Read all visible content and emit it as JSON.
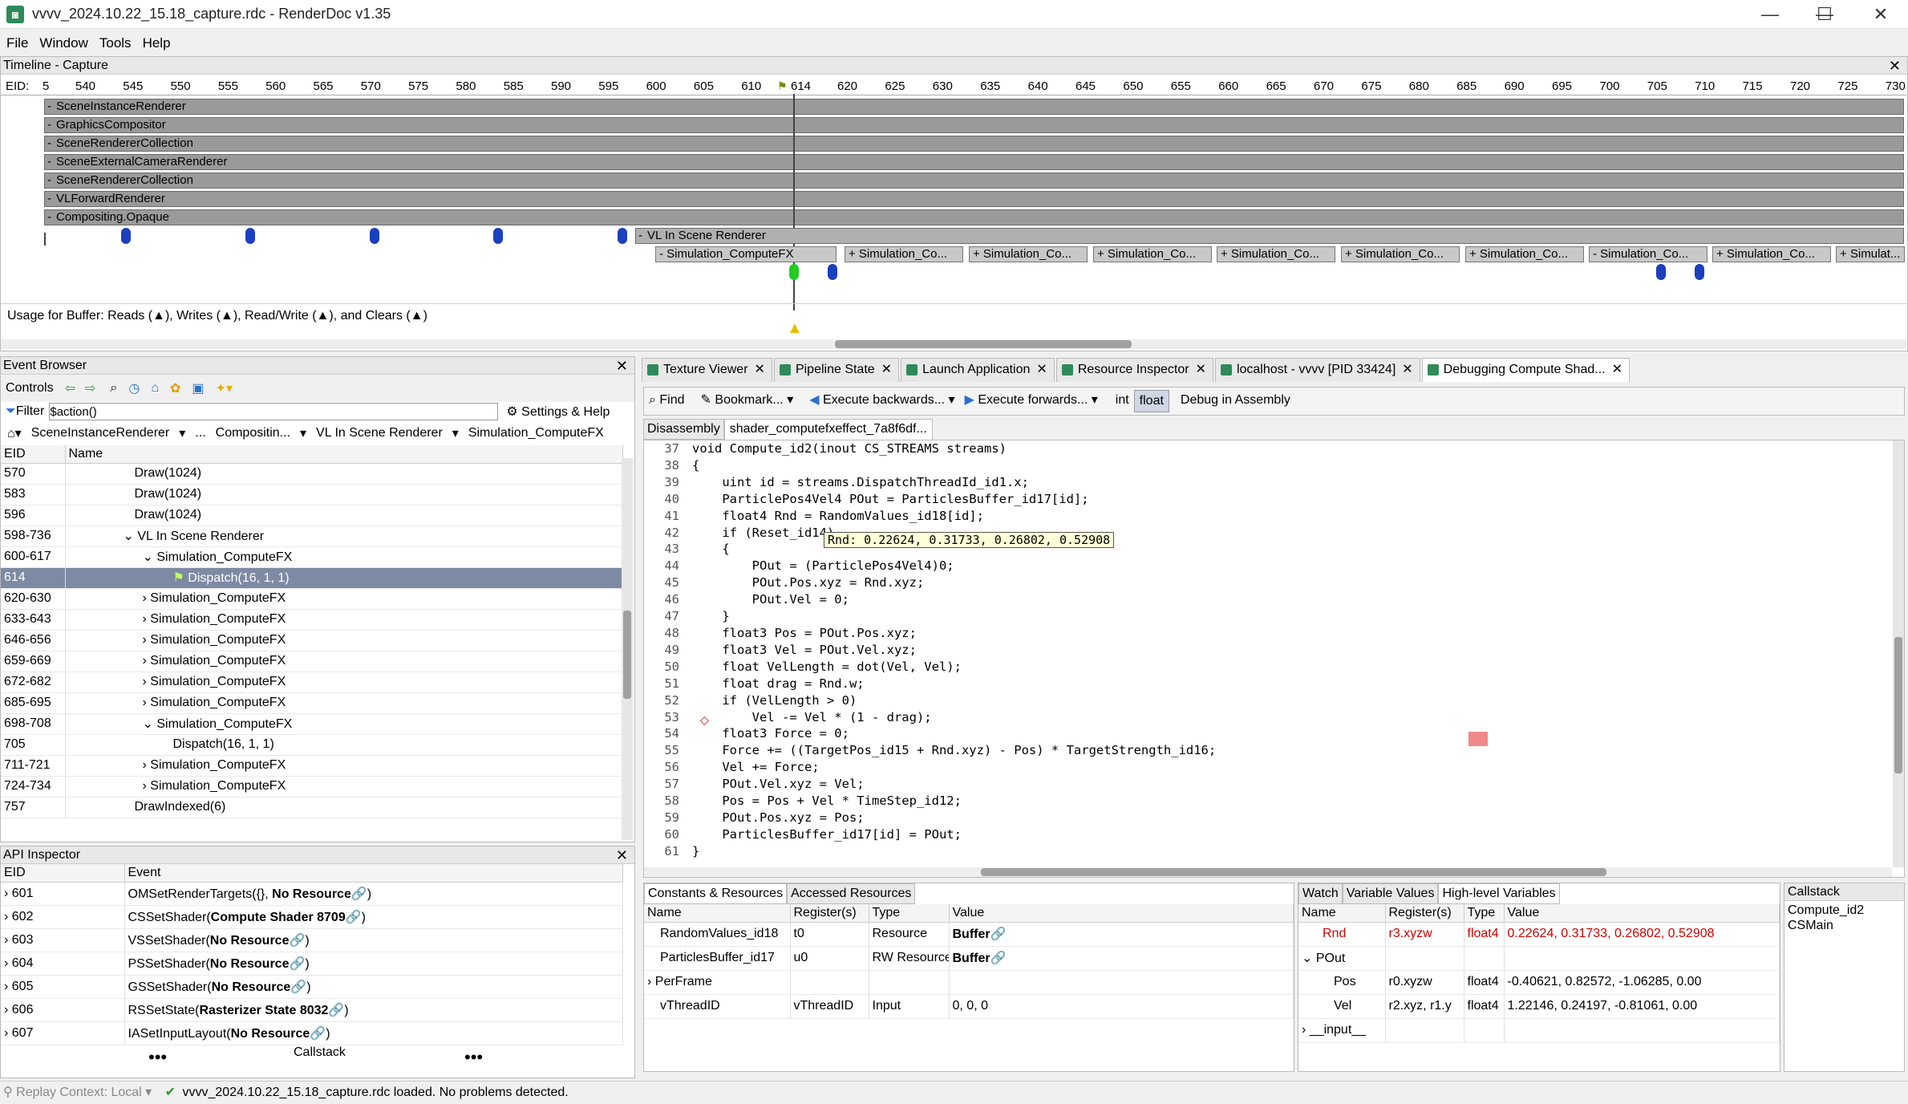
{
  "window": {
    "title": "vvvv_2024.10.22_15.18_capture.rdc - RenderDoc v1.35"
  },
  "menu": [
    "File",
    "Window",
    "Tools",
    "Help"
  ],
  "timeline": {
    "header": "Timeline - Capture",
    "eid_label": "EID:",
    "ticks": [
      "5",
      "540",
      "545",
      "550",
      "555",
      "560",
      "565",
      "570",
      "575",
      "580",
      "585",
      "590",
      "595",
      "600",
      "605",
      "610",
      "614",
      "620",
      "625",
      "630",
      "635",
      "640",
      "645",
      "650",
      "655",
      "660",
      "665",
      "670",
      "675",
      "680",
      "685",
      "690",
      "695",
      "700",
      "705",
      "710",
      "715",
      "720",
      "725",
      "730"
    ],
    "rows": [
      "SceneInstanceRenderer",
      "GraphicsCompositor",
      "SceneRendererCollection",
      "SceneExternalCameraRenderer",
      "SceneRendererCollection",
      "VLForwardRenderer",
      "Compositing.Opaque"
    ],
    "vl_row": "VL In Scene Renderer",
    "sim_boxes": [
      "- Simulation_ComputeFX",
      "+ Simulation_Co...",
      "+ Simulation_Co...",
      "+ Simulation_Co...",
      "+ Simulation_Co...",
      "+ Simulation_Co...",
      "+ Simulation_Co...",
      "- Simulation_Co...",
      "+ Simulation_Co...",
      "+ Simulat..."
    ],
    "usage": "Usage for Buffer: Reads (▲), Writes (▲), Read/Write (▲), and Clears (▲)"
  },
  "event_browser": {
    "header": "Event Browser",
    "controls_label": "Controls",
    "filter_label": "Filter",
    "filter_value": "$action()",
    "settings": "Settings & Help",
    "breadcrumbs": [
      "SceneInstanceRenderer",
      "...",
      "Compositin...",
      "VL In Scene Renderer",
      "Simulation_ComputeFX"
    ],
    "columns": [
      "EID",
      "Name"
    ],
    "rows": [
      {
        "eid": "570",
        "name": "Draw(1024)",
        "indent": 3,
        "exp": ""
      },
      {
        "eid": "583",
        "name": "Draw(1024)",
        "indent": 3,
        "exp": ""
      },
      {
        "eid": "596",
        "name": "Draw(1024)",
        "indent": 3,
        "exp": ""
      },
      {
        "eid": "598-736",
        "name": "VL In Scene Renderer",
        "indent": 3,
        "exp": "v"
      },
      {
        "eid": "600-617",
        "name": "Simulation_ComputeFX",
        "indent": 4,
        "exp": "v"
      },
      {
        "eid": "614",
        "name": "Dispatch(16, 1, 1)",
        "indent": 5,
        "exp": "",
        "selected": true
      },
      {
        "eid": "620-630",
        "name": "Simulation_ComputeFX",
        "indent": 4,
        "exp": ">"
      },
      {
        "eid": "633-643",
        "name": "Simulation_ComputeFX",
        "indent": 4,
        "exp": ">"
      },
      {
        "eid": "646-656",
        "name": "Simulation_ComputeFX",
        "indent": 4,
        "exp": ">"
      },
      {
        "eid": "659-669",
        "name": "Simulation_ComputeFX",
        "indent": 4,
        "exp": ">"
      },
      {
        "eid": "672-682",
        "name": "Simulation_ComputeFX",
        "indent": 4,
        "exp": ">"
      },
      {
        "eid": "685-695",
        "name": "Simulation_ComputeFX",
        "indent": 4,
        "exp": ">"
      },
      {
        "eid": "698-708",
        "name": "Simulation_ComputeFX",
        "indent": 4,
        "exp": "v"
      },
      {
        "eid": "705",
        "name": "Dispatch(16, 1, 1)",
        "indent": 5,
        "exp": ""
      },
      {
        "eid": "711-721",
        "name": "Simulation_ComputeFX",
        "indent": 4,
        "exp": ">"
      },
      {
        "eid": "724-734",
        "name": "Simulation_ComputeFX",
        "indent": 4,
        "exp": ">"
      },
      {
        "eid": "757",
        "name": "DrawIndexed(6)",
        "indent": 3,
        "exp": ""
      }
    ]
  },
  "api_inspector": {
    "header": "API Inspector",
    "columns": [
      "EID",
      "Event"
    ],
    "rows": [
      {
        "eid": "601",
        "fn": "OMSetRenderTargets(",
        "arg": "{}, ",
        "bold": "No Resource",
        "end": ")"
      },
      {
        "eid": "602",
        "fn": "CSSetShader(",
        "arg": "",
        "bold": "Compute Shader 8709",
        "end": ")"
      },
      {
        "eid": "603",
        "fn": "VSSetShader(",
        "arg": "",
        "bold": "No Resource",
        "end": ")"
      },
      {
        "eid": "604",
        "fn": "PSSetShader(",
        "arg": "",
        "bold": "No Resource",
        "end": ")"
      },
      {
        "eid": "605",
        "fn": "GSSetShader(",
        "arg": "",
        "bold": "No Resource",
        "end": ")"
      },
      {
        "eid": "606",
        "fn": "RSSetState(",
        "arg": "",
        "bold": "Rasterizer State 8032",
        "end": ")"
      },
      {
        "eid": "607",
        "fn": "IASetInputLayout(",
        "arg": "",
        "bold": "No Resource",
        "end": ")"
      }
    ],
    "callstack": "Callstack"
  },
  "tabs": [
    {
      "label": "Texture Viewer"
    },
    {
      "label": "Pipeline State"
    },
    {
      "label": "Launch Application"
    },
    {
      "label": "Resource Inspector"
    },
    {
      "label": "localhost - vvvv [PID 33424]"
    },
    {
      "label": "Debugging Compute Shad...",
      "active": true
    }
  ],
  "debug_toolbar": {
    "find": "Find",
    "bookmark": "Bookmark...",
    "exec_back": "Execute backwards...",
    "exec_fwd": "Execute forwards...",
    "int": "int",
    "float": "float",
    "asm": "Debug in Assembly"
  },
  "code_tabs": [
    "Disassembly",
    "shader_computefxeffect_7a8f6df..."
  ],
  "code": [
    {
      "n": "37",
      "t": "void Compute_id2(inout CS_STREAMS streams)"
    },
    {
      "n": "38",
      "t": "{"
    },
    {
      "n": "39",
      "t": "    uint id = streams.DispatchThreadId_id1.x;"
    },
    {
      "n": "40",
      "t": "    ParticlePos4Vel4 POut = ParticlesBuffer_id17[id];"
    },
    {
      "n": "41",
      "t": "    float4 Rnd = RandomValues_id18[id];"
    },
    {
      "n": "42",
      "t": "    if (Reset_id14)"
    },
    {
      "n": "43",
      "t": "    {"
    },
    {
      "n": "44",
      "t": "        POut = (ParticlePos4Vel4)0;"
    },
    {
      "n": "45",
      "t": "        POut.Pos.xyz = Rnd.xyz;"
    },
    {
      "n": "46",
      "t": "        POut.Vel = 0;"
    },
    {
      "n": "47",
      "t": "    }"
    },
    {
      "n": "48",
      "t": "    float3 Pos = POut.Pos.xyz;"
    },
    {
      "n": "49",
      "t": "    float3 Vel = POut.Vel.xyz;"
    },
    {
      "n": "50",
      "t": "    float VelLength = dot(Vel, Vel);"
    },
    {
      "n": "51",
      "t": "    float drag = Rnd.w;"
    },
    {
      "n": "52",
      "t": "    if (VelLength > 0)"
    },
    {
      "n": "53",
      "t": "        Vel -= Vel * (1 - drag);"
    },
    {
      "n": "54",
      "t": "    float3 Force = 0;"
    },
    {
      "n": "55",
      "t": "    Force += ((TargetPos_id15 + Rnd.xyz) - Pos) * TargetStrength_id16;"
    },
    {
      "n": "56",
      "t": "    Vel += Force;"
    },
    {
      "n": "57",
      "t": "    POut.Vel.xyz = Vel;"
    },
    {
      "n": "58",
      "t": "    Pos = Pos + Vel * TimeStep_id12;"
    },
    {
      "n": "59",
      "t": "    POut.Pos.xyz = Pos;"
    },
    {
      "n": "60",
      "t": "    ParticlesBuffer_id17[id] = POut;"
    },
    {
      "n": "61",
      "t": "}"
    }
  ],
  "tooltip": "Rnd: 0.22624, 0.31733, 0.26802, 0.52908",
  "resources": {
    "tabs": [
      "Constants & Resources",
      "Accessed Resources"
    ],
    "columns": [
      "Name",
      "Register(s)",
      "Type",
      "Value"
    ],
    "rows": [
      {
        "name": "RandomValues_id18",
        "reg": "t0",
        "type": "Resource",
        "value": "Buffer"
      },
      {
        "name": "ParticlesBuffer_id17",
        "reg": "u0",
        "type": "RW Resource",
        "value": "Buffer"
      },
      {
        "name": "PerFrame",
        "reg": "",
        "type": "",
        "value": "",
        "exp": ">"
      },
      {
        "name": "vThreadID",
        "reg": "vThreadID",
        "type": "Input",
        "value": "0, 0, 0"
      }
    ]
  },
  "watch": {
    "tabs": [
      "Watch",
      "Variable Values",
      "High-level Variables"
    ],
    "columns": [
      "Name",
      "Register(s)",
      "Type",
      "Value"
    ],
    "rows": [
      {
        "name": "Rnd",
        "reg": "r3.xyzw",
        "type": "float4",
        "value": "0.22624, 0.31733, 0.26802, 0.52908",
        "red": true
      },
      {
        "name": "POut",
        "reg": "",
        "type": "",
        "value": "",
        "exp": "v"
      },
      {
        "name": "Pos",
        "reg": "r0.xyzw",
        "type": "float4",
        "value": "-0.40621, 0.82572, -1.06285, 0.00",
        "child": true
      },
      {
        "name": "Vel",
        "reg": "r2.xyz, r1.y",
        "type": "float4",
        "value": "1.22146, 0.24197, -0.81061, 0.00",
        "child": true
      },
      {
        "name": "__input__",
        "reg": "",
        "type": "",
        "value": "",
        "exp": ">"
      }
    ]
  },
  "callstack": {
    "header": "Callstack",
    "items": [
      "Compute_id2",
      "CSMain"
    ]
  },
  "status": {
    "context": "Replay Context: Local",
    "message": "vvvv_2024.10.22_15.18_capture.rdc loaded. No problems detected."
  }
}
